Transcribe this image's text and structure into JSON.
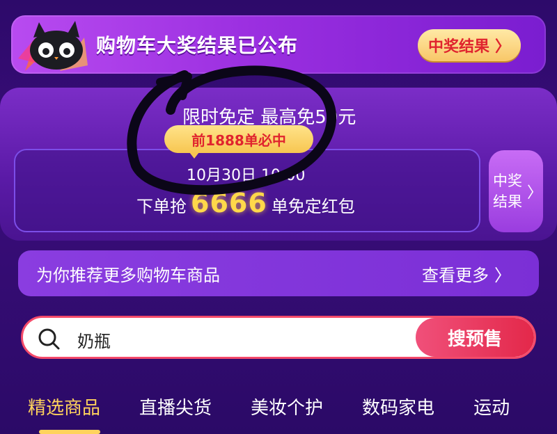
{
  "banner": {
    "title": "购物车大奖结果已公布",
    "button_label": "中奖结果",
    "button_chevron": "〉"
  },
  "promo": {
    "title": "限时免定 最高免50元",
    "pill_label": "前1888单必中",
    "date": "10月30日 10:00",
    "line_prefix": "下单抢",
    "line_number": "6666",
    "line_suffix": "单免定红包",
    "side_button_label": "中奖结果",
    "side_button_chevron": "〉"
  },
  "recommend": {
    "label": "为你推荐更多购物车商品",
    "more_label": "查看更多",
    "more_chevron": "〉"
  },
  "search": {
    "value": "奶瓶",
    "button_label": "搜预售"
  },
  "tabs": [
    {
      "label": "精选商品",
      "active": true
    },
    {
      "label": "直播尖货",
      "active": false
    },
    {
      "label": "美妆个护",
      "active": false
    },
    {
      "label": "数码家电",
      "active": false
    },
    {
      "label": "运动",
      "active": false
    }
  ],
  "colors": {
    "accent_gold": "#ffd35c",
    "accent_red": "#e0242e",
    "search_border": "#f44a6a"
  }
}
